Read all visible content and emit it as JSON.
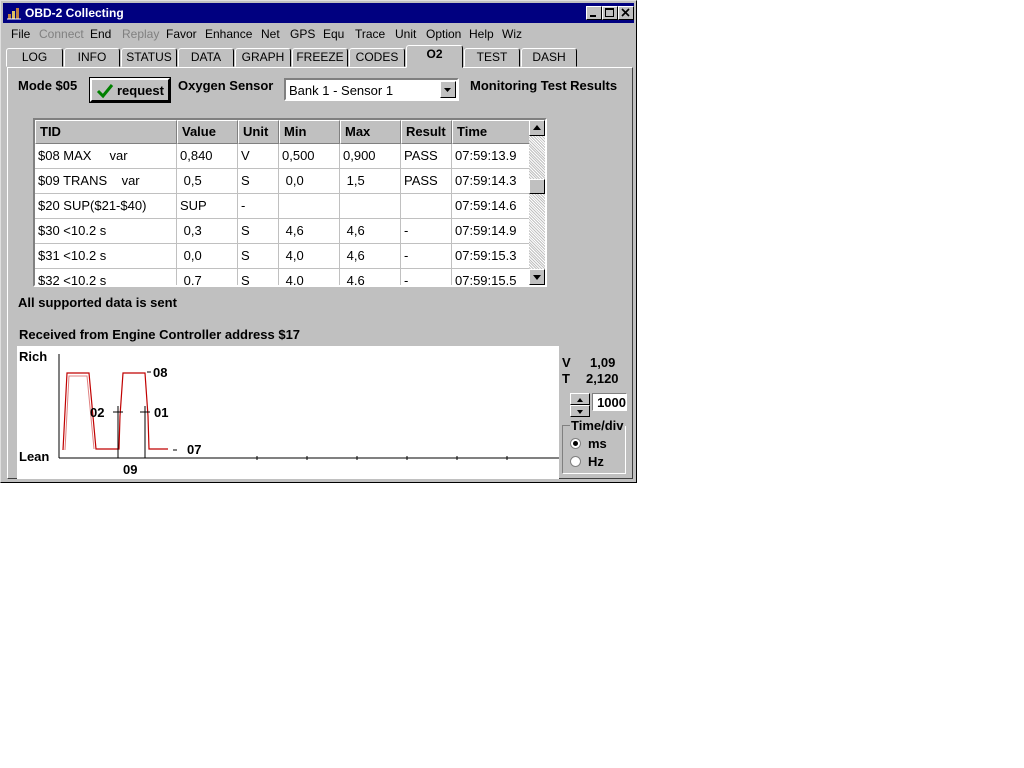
{
  "window": {
    "title": "OBD-2 Collecting"
  },
  "menu": [
    {
      "label": "File",
      "enabled": true
    },
    {
      "label": "Connect",
      "enabled": false
    },
    {
      "label": "End",
      "enabled": true
    },
    {
      "label": "Replay",
      "enabled": false
    },
    {
      "label": "Favor",
      "enabled": true
    },
    {
      "label": "Enhance",
      "enabled": true
    },
    {
      "label": "Net",
      "enabled": true
    },
    {
      "label": "GPS",
      "enabled": true
    },
    {
      "label": "Equ",
      "enabled": true
    },
    {
      "label": "Trace",
      "enabled": true
    },
    {
      "label": "Unit",
      "enabled": true
    },
    {
      "label": "Option",
      "enabled": true
    },
    {
      "label": "Help",
      "enabled": true
    },
    {
      "label": "Wiz",
      "enabled": true
    }
  ],
  "tabs": [
    "LOG",
    "INFO",
    "STATUS",
    "DATA",
    "GRAPH",
    "FREEZE",
    "CODES",
    "O2",
    "TEST",
    "DASH"
  ],
  "active_tab": "O2",
  "mode_label": "Mode $05",
  "request_label": "request",
  "sensor_label": "Oxygen Sensor",
  "sensor_value": "Bank 1 - Sensor 1",
  "monitor_label": "Monitoring Test Results",
  "table": {
    "headers": [
      "TID",
      "Value",
      "Unit",
      "Min",
      "Max",
      "Result",
      "Time"
    ],
    "rows": [
      [
        "$08 MAX     var",
        "0,840",
        "V",
        "0,500",
        "0,900",
        "PASS",
        "07:59:13.9"
      ],
      [
        "$09 TRANS    var",
        " 0,5",
        "S",
        " 0,0",
        " 1,5",
        "PASS",
        "07:59:14.3"
      ],
      [
        "$20 SUP($21-$40)",
        "SUP",
        "-",
        "",
        "",
        "",
        "07:59:14.6"
      ],
      [
        "$30 <10.2 s",
        " 0,3",
        "S",
        " 4,6",
        " 4,6",
        "-",
        "07:59:14.9"
      ],
      [
        "$31 <10.2 s",
        " 0,0",
        "S",
        " 4,0",
        " 4,6",
        "-",
        "07:59:15.3"
      ],
      [
        "$32 <10.2 s",
        " 0,7",
        "S",
        " 4,0",
        " 4,6",
        "-",
        "07:59:15.5"
      ]
    ]
  },
  "status_text": "All supported data is sent",
  "received_text": "Received from Engine Controller address $17",
  "plot": {
    "y_top_label": "Rich",
    "y_bottom_label": "Lean",
    "markers": [
      "08",
      "02",
      "01",
      "07",
      "09"
    ]
  },
  "readout": {
    "v_label": "V",
    "v_value": "1,09",
    "t_label": "T",
    "t_value": "2,120"
  },
  "spinner_value": "1000",
  "timediv": {
    "label": "Time/div",
    "options": [
      "ms",
      "Hz"
    ],
    "selected": "ms"
  }
}
